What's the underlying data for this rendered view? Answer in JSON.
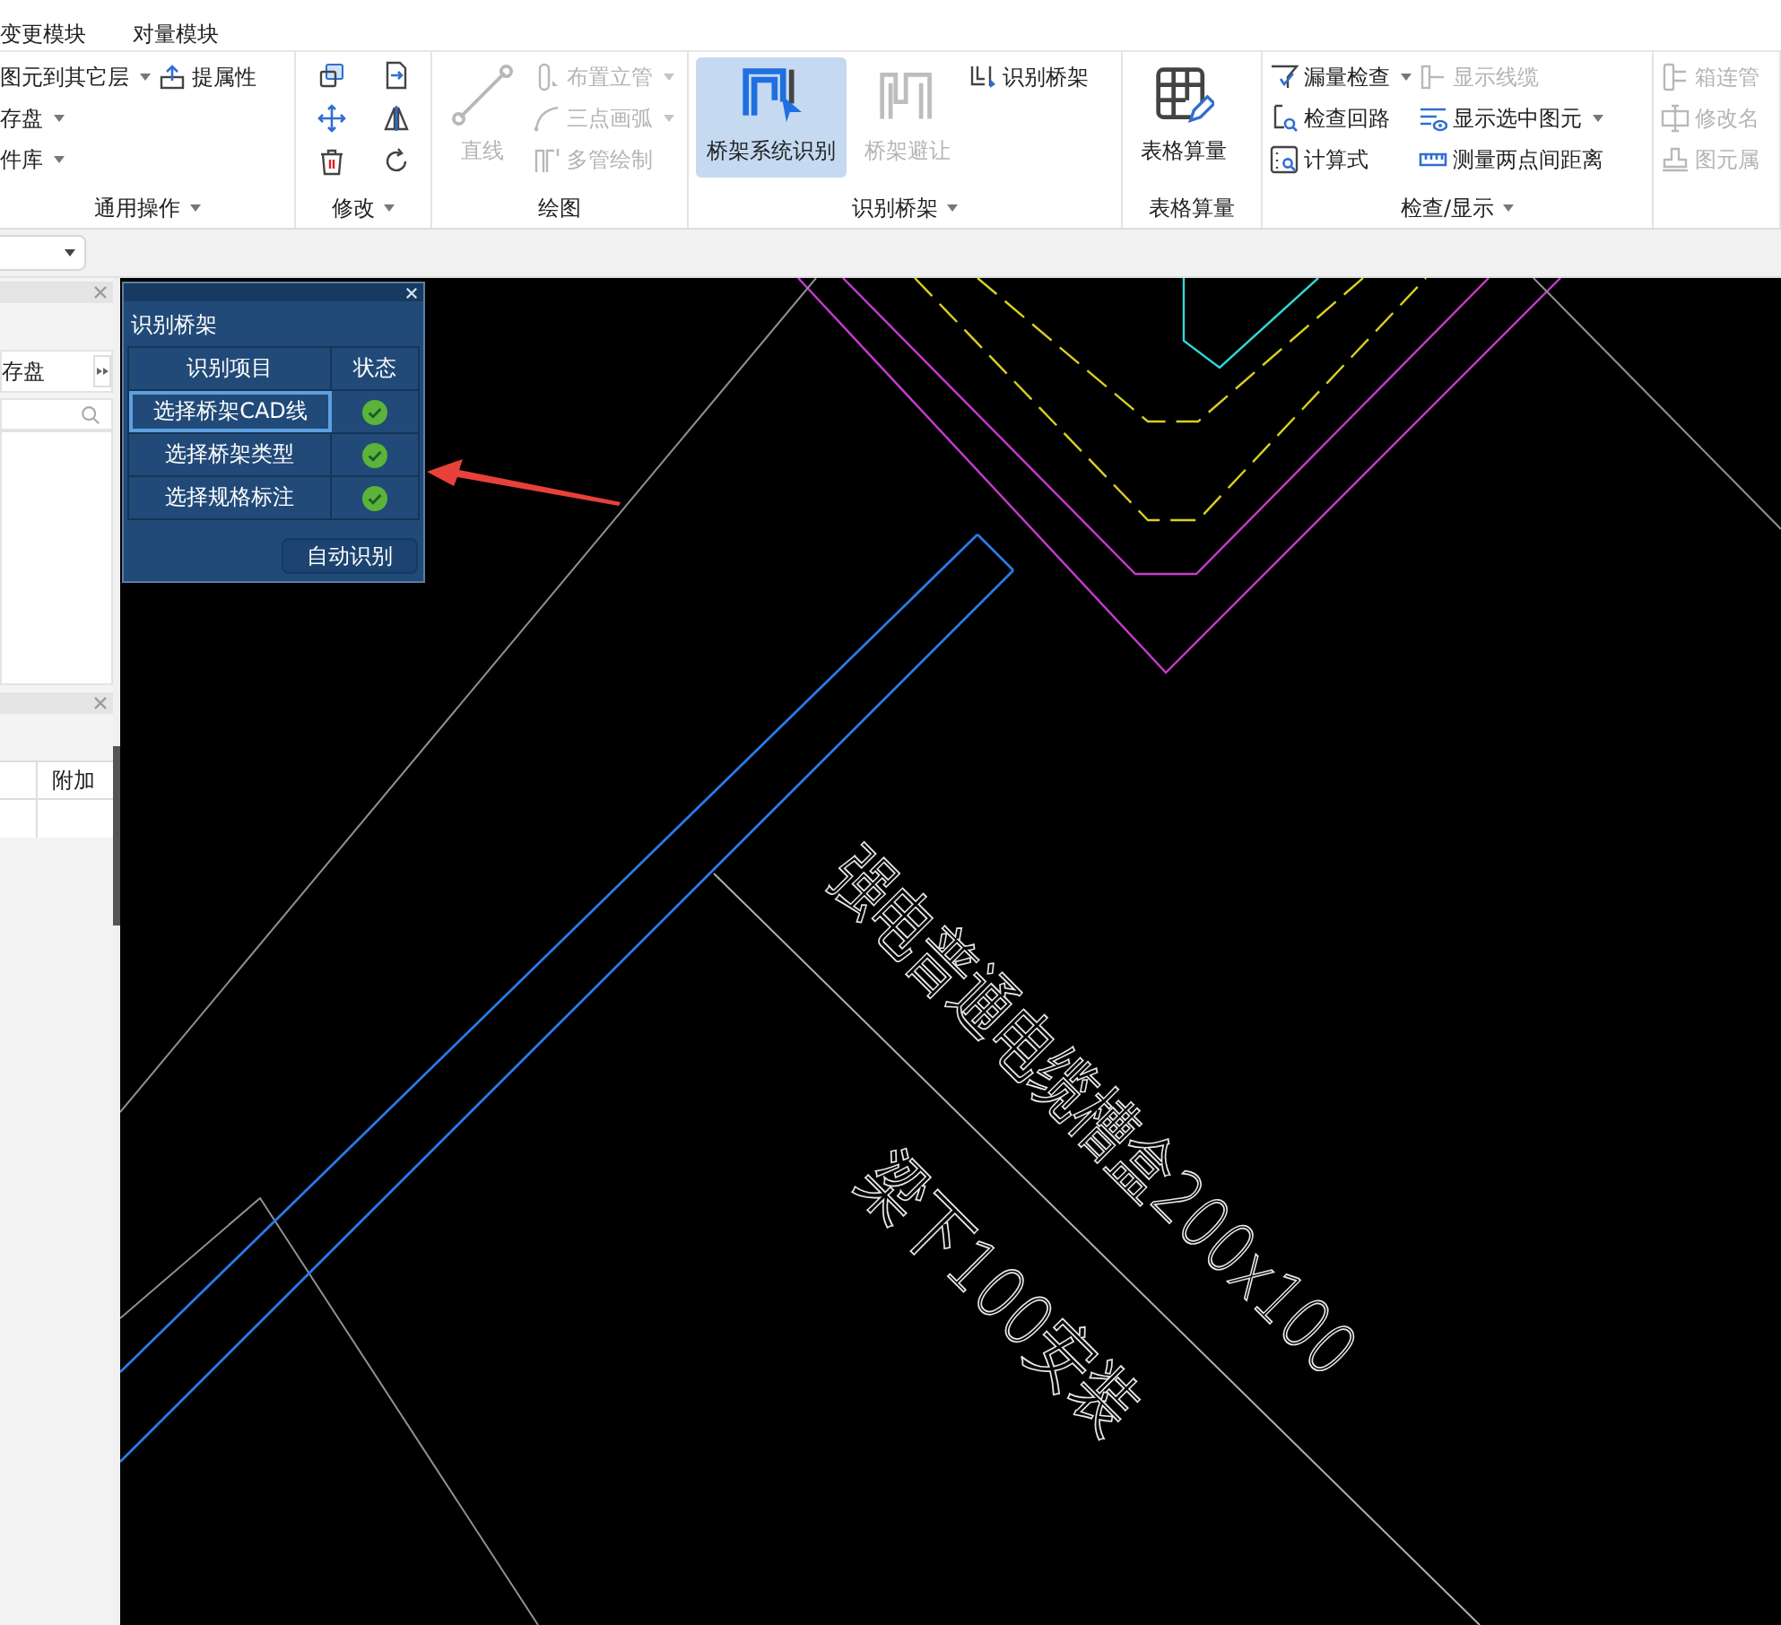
{
  "menu_tabs": [
    {
      "label": "变更模块"
    },
    {
      "label": "对量模块"
    }
  ],
  "ribbon": {
    "groups": [
      {
        "label": "通用操作",
        "dropdown": true,
        "columns": [
          [
            {
              "kind": "small",
              "label": "图元到其它层",
              "dropdown": true,
              "disabled": false
            },
            {
              "kind": "small",
              "label": "存盘",
              "dropdown": true,
              "disabled": false
            },
            {
              "kind": "small",
              "label": "件库",
              "dropdown": true,
              "disabled": false
            }
          ],
          [
            {
              "kind": "small",
              "label": "提属性",
              "dropdown": false,
              "disabled": false
            }
          ]
        ]
      },
      {
        "label": "修改",
        "dropdown": true,
        "columns": [
          [
            {
              "kind": "icon",
              "disabled": false
            },
            {
              "kind": "icon",
              "disabled": false
            },
            {
              "kind": "icon",
              "disabled": false
            }
          ],
          [
            {
              "kind": "icon",
              "disabled": false
            },
            {
              "kind": "icon",
              "disabled": false
            },
            {
              "kind": "icon",
              "disabled": false
            }
          ]
        ]
      },
      {
        "label": "绘图",
        "dropdown": false,
        "columns": [
          [
            {
              "kind": "large",
              "label": "直线",
              "disabled": true,
              "active": false
            }
          ],
          [
            {
              "kind": "small",
              "label": "布置立管",
              "dropdown": true,
              "disabled": true
            },
            {
              "kind": "small",
              "label": "三点画弧",
              "dropdown": true,
              "disabled": true
            },
            {
              "kind": "small",
              "label": "多管绘制",
              "dropdown": false,
              "disabled": true
            }
          ]
        ]
      },
      {
        "label": "识别桥架",
        "dropdown": true,
        "columns": [
          [
            {
              "kind": "large",
              "label": "桥架系统识别",
              "disabled": false,
              "active": true
            }
          ],
          [
            {
              "kind": "large",
              "label": "桥架避让",
              "disabled": true,
              "active": false
            }
          ],
          [
            {
              "kind": "small",
              "label": "识别桥架",
              "dropdown": false,
              "disabled": false
            }
          ]
        ]
      },
      {
        "label": "表格算量",
        "dropdown": false,
        "columns": [
          [
            {
              "kind": "large",
              "label": "表格算量",
              "disabled": false,
              "active": false
            }
          ]
        ]
      },
      {
        "label": "检查/显示",
        "dropdown": true,
        "columns": [
          [
            {
              "kind": "small",
              "label": "漏量检查",
              "dropdown": true,
              "disabled": false
            },
            {
              "kind": "small",
              "label": "检查回路",
              "dropdown": false,
              "disabled": false
            },
            {
              "kind": "small",
              "label": "计算式",
              "dropdown": false,
              "disabled": false
            }
          ],
          [
            {
              "kind": "small",
              "label": "显示线缆",
              "dropdown": false,
              "disabled": true
            },
            {
              "kind": "small",
              "label": "显示选中图元",
              "dropdown": true,
              "disabled": false
            },
            {
              "kind": "small",
              "label": "测量两点间距离",
              "dropdown": false,
              "disabled": false
            }
          ]
        ]
      },
      {
        "columns": [
          [
            {
              "kind": "small",
              "label": "箱连管",
              "dropdown": false,
              "disabled": true
            },
            {
              "kind": "small",
              "label": "修改名",
              "dropdown": false,
              "disabled": true
            },
            {
              "kind": "small",
              "label": "图元属",
              "dropdown": false,
              "disabled": true
            }
          ]
        ]
      }
    ]
  },
  "left_panel": {
    "toolbar_item": "存盘",
    "bottom_table": {
      "columns": [
        "附加"
      ]
    }
  },
  "dialog": {
    "title": "识别桥架",
    "columns": [
      "识别项目",
      "状态"
    ],
    "rows": [
      {
        "item": "选择桥架CAD线",
        "done": true,
        "selected": true
      },
      {
        "item": "选择桥架类型",
        "done": true,
        "selected": false
      },
      {
        "item": "选择规格标注",
        "done": true,
        "selected": false
      }
    ],
    "button": "自动识别"
  },
  "drawing": {
    "labels": [
      "强电普通电缆槽盒200x100",
      "梁下100安装"
    ]
  }
}
